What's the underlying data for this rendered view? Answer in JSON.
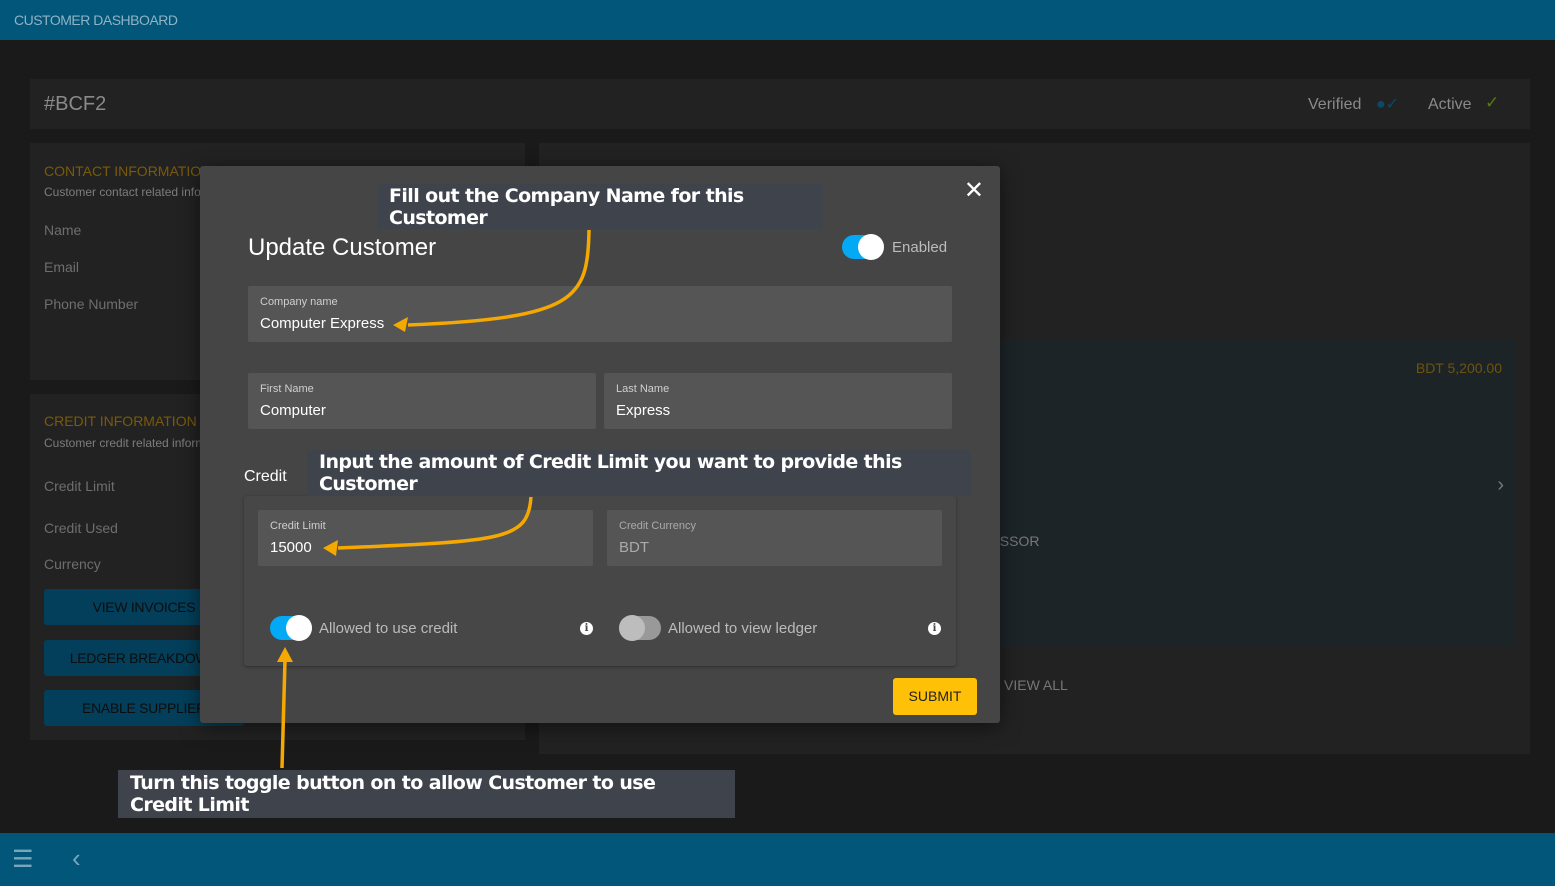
{
  "app": {
    "title": "CUSTOMER DASHBOARD"
  },
  "header": {
    "customer_id": "#BCF2",
    "verified": "Verified",
    "active": "Active"
  },
  "contact": {
    "title": "CONTACT INFORMATION",
    "subtitle": "Customer contact related information",
    "fields": [
      "Name",
      "Email",
      "Phone Number"
    ]
  },
  "credit_info": {
    "title": "CREDIT INFORMATION",
    "subtitle": "Customer credit related information",
    "fields": [
      "Credit Limit",
      "Credit Used",
      "Currency"
    ],
    "buttons": [
      "VIEW INVOICES",
      "LEDGER BREAKDOWN",
      "ENABLE SUPPLIER"
    ]
  },
  "orders": {
    "amount": "BDT 5,200.00",
    "item_text": "PROCESSOR",
    "view_all": "VIEW ALL"
  },
  "modal": {
    "title": "Update Customer",
    "enabled_label": "Enabled",
    "enabled": true,
    "company_name": {
      "label": "Company name",
      "value": "Computer Express"
    },
    "first_name": {
      "label": "First Name",
      "value": "Computer"
    },
    "last_name": {
      "label": "Last Name",
      "value": "Express"
    },
    "credit_section": "Credit",
    "credit_limit": {
      "label": "Credit Limit",
      "value": "15000"
    },
    "credit_currency": {
      "label": "Credit Currency",
      "value": "BDT"
    },
    "allow_credit": {
      "label": "Allowed to use credit",
      "on": true
    },
    "allow_ledger": {
      "label": "Allowed to view ledger",
      "on": false
    },
    "submit": "SUBMIT"
  },
  "callouts": {
    "company": "Fill out the Company Name for this Customer",
    "credit": "Input the amount of Credit Limit you want to provide this Customer",
    "toggle": "Turn this toggle button on to allow Customer to use Credit Limit"
  },
  "colors": {
    "topbar": "#02567a",
    "accent": "#03a9f4",
    "submit": "#ffc107",
    "arrow": "#f5a800"
  }
}
